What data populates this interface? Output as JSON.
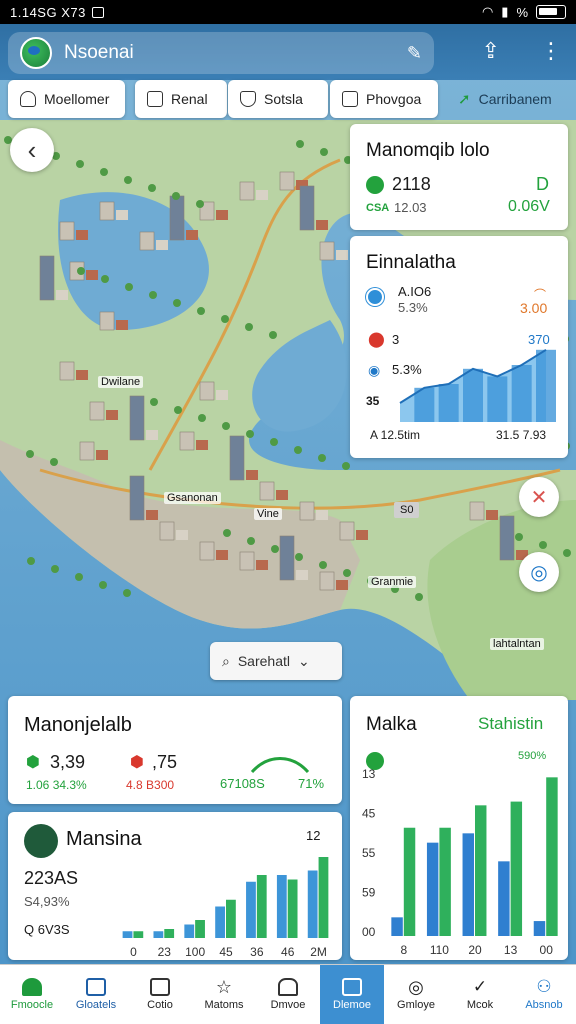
{
  "status_bar": {
    "time": "1.14SG X73"
  },
  "app_bar": {
    "title": "Nsoenai"
  },
  "chips": [
    {
      "label": "Moellomer",
      "icon": "home-outline-icon"
    },
    {
      "label": "Renal",
      "icon": "building-icon"
    },
    {
      "label": "Sotsla",
      "icon": "shield-icon"
    },
    {
      "label": "Phovgoa",
      "icon": "checkbox-icon"
    },
    {
      "label": "Carribanem",
      "icon": "arrow-icon"
    }
  ],
  "map_labels": {
    "l1": "Dwilane",
    "l2": "Gsanonan",
    "l3": "Vine",
    "l4": "S0",
    "l5": "Granmie",
    "l6": "lahtalntan"
  },
  "search_area": {
    "label": "Sarehatl"
  },
  "card_top": {
    "title": "Manomqib lolo",
    "value": "2118",
    "sub": "12.03",
    "right_value": "D",
    "right_sub": "0.06V",
    "tag": "CSA"
  },
  "card_chart": {
    "title": "Einnalatha",
    "r1_label": "A.IO6",
    "r1_sub": "5.3%",
    "r1_right": "3.00",
    "r2_label": "3",
    "r2_right": "370",
    "r3_label": "5.3%",
    "side_label": "35",
    "footer_left": "A 12.5tim",
    "footer_right": "31.5 7.93"
  },
  "card_stats": {
    "title": "Manonjelalb",
    "v1": "3,39",
    "v1_sub": "1.06 34.3%",
    "v2": ",75",
    "v2_sub": "4.8 B300",
    "v3": "67108S",
    "v3_pct": "71%"
  },
  "card_mansina": {
    "title": "Mansina",
    "value": "223AS",
    "sub": "S4,93%",
    "footer": "Q 6V3S",
    "top_label": "12"
  },
  "card_stat_right": {
    "title": "Malka",
    "title_right": "Stahistin",
    "percent": "590%"
  },
  "bottom_nav": [
    {
      "label": "Fmoocle",
      "icon": "home-icon"
    },
    {
      "label": "Gloatels",
      "icon": "bank-icon"
    },
    {
      "label": "Cotio",
      "icon": "chart-icon"
    },
    {
      "label": "Matoms",
      "icon": "star-icon"
    },
    {
      "label": "Dmvoe",
      "icon": "house-icon"
    },
    {
      "label": "Dlemoe",
      "icon": "building-icon"
    },
    {
      "label": "Gmloye",
      "icon": "target-icon"
    },
    {
      "label": "Mcok",
      "icon": "checkmark-icon"
    },
    {
      "label": "Absnob",
      "icon": "people-icon"
    }
  ],
  "colors": {
    "appbar": "#3b7fb5",
    "accent_green": "#23a23d",
    "accent_blue": "#1f78c8",
    "active_nav": "#3d8fd1"
  },
  "chart_data": [
    {
      "type": "area",
      "title": "Einnalatha",
      "x": [
        1,
        2,
        3,
        4,
        5,
        6,
        7
      ],
      "values": [
        10,
        18,
        20,
        28,
        24,
        30,
        38
      ],
      "ylim": [
        0,
        40
      ]
    },
    {
      "type": "bar",
      "title": "Mansina",
      "categories": [
        "0",
        "23",
        "100",
        "45",
        "36",
        "46",
        "2M"
      ],
      "series": [
        {
          "values": [
            3,
            3,
            6,
            14,
            25,
            28,
            30
          ]
        },
        {
          "values": [
            3,
            4,
            8,
            17,
            28,
            26,
            36
          ]
        }
      ],
      "ylim": [
        0,
        40
      ]
    },
    {
      "type": "bar",
      "title": "Malka",
      "categories": [
        "8",
        "110",
        "20",
        "13",
        "00"
      ],
      "y_ticks": [
        "13",
        "45",
        "55",
        "59",
        "00"
      ],
      "series": [
        {
          "values": [
            10,
            50,
            55,
            40,
            8
          ]
        },
        {
          "values": [
            58,
            58,
            70,
            72,
            85
          ]
        }
      ],
      "ylim": [
        0,
        90
      ]
    }
  ]
}
